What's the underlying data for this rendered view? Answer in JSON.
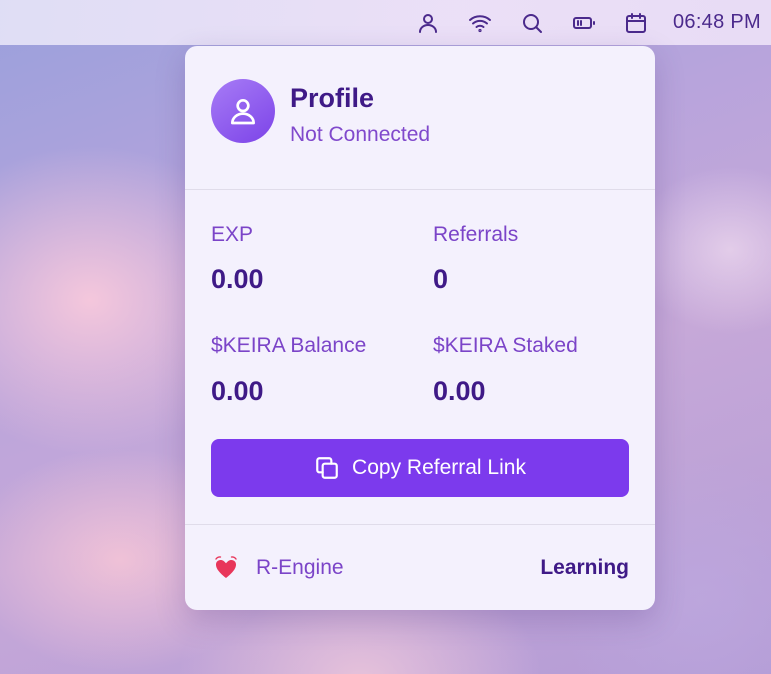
{
  "menubar": {
    "icons": [
      "user-icon",
      "wifi-icon",
      "search-icon",
      "battery-icon",
      "calendar-icon"
    ],
    "clock": "06:48 PM"
  },
  "profile": {
    "title": "Profile",
    "status": "Not Connected"
  },
  "stats": {
    "exp_label": "EXP",
    "exp_value": "0.00",
    "referrals_label": "Referrals",
    "referrals_value": "0",
    "balance_label": "$KEIRA Balance",
    "balance_value": "0.00",
    "staked_label": "$KEIRA Staked",
    "staked_value": "0.00"
  },
  "copy_button": {
    "label": "Copy Referral Link"
  },
  "footer": {
    "engine_label": "R-Engine",
    "mode_label": "Learning"
  },
  "colors": {
    "accent": "#7c3aed",
    "heading": "#3f1a87",
    "label": "#7b44c8",
    "card_bg": "#f4f1fd",
    "heart": "#e8365a"
  }
}
